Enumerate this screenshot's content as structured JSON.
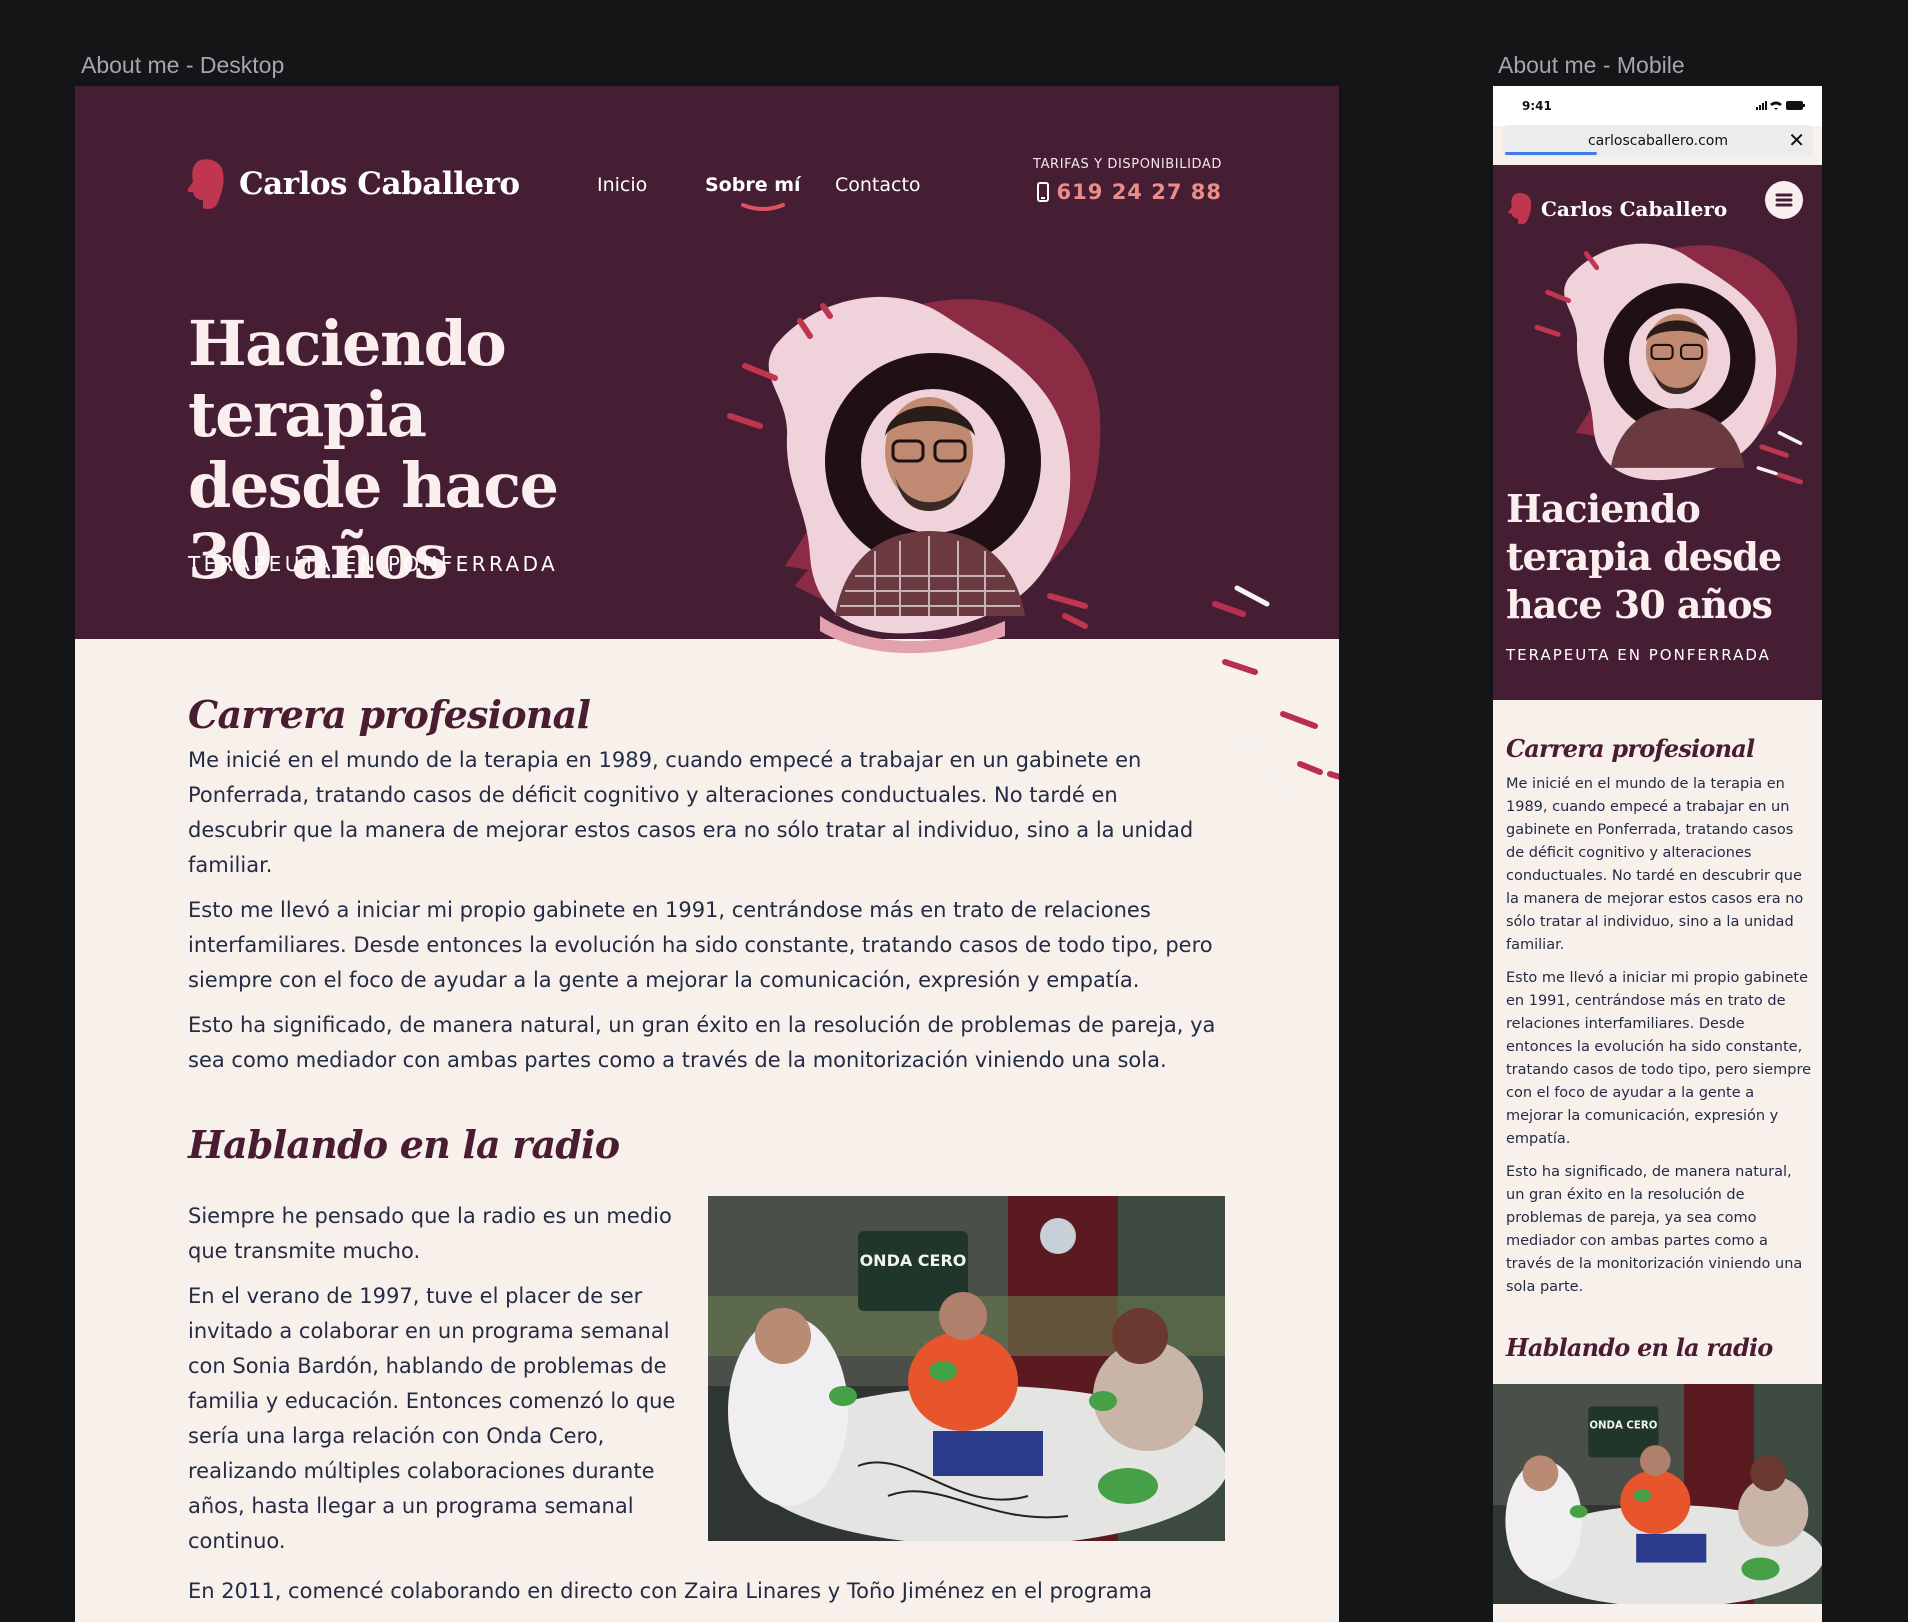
{
  "frames": {
    "desktop_label": "About me - Desktop",
    "mobile_label": "About me - Mobile"
  },
  "brand": {
    "name": "Carlos Caballero",
    "accent": "#ec8c8a",
    "hero_bg": "#461e34",
    "content_bg": "#f8f0eb"
  },
  "nav": {
    "items": [
      "Inicio",
      "Sobre mí",
      "Contacto"
    ],
    "active": "Sobre mí"
  },
  "contact": {
    "caption": "TARIFAS Y DISPONIBILIDAD",
    "phone": "619 24 27 88"
  },
  "hero": {
    "title": "Haciendo terapia desde hace 30 años",
    "subtitle": "TERAPEUTA EN PONFERRADA"
  },
  "career": {
    "heading": "Carrera profesional",
    "paragraphs": [
      "Me inicié en el mundo de la terapia en 1989, cuando empecé a trabajar en un gabinete en Ponferrada, tratando casos de déficit cognitivo y alteraciones conductuales. No tardé en descubrir que la manera de mejorar estos casos era no sólo tratar al individuo, sino a la unidad familiar.",
      "Esto me llevó a iniciar mi propio gabinete en 1991, centrándose más en trato de relaciones interfamiliares. Desde entonces la evolución ha sido constante, tratando casos de todo tipo, pero siempre con el foco de ayudar a la gente a mejorar la comunicación, expresión y empatía.",
      "Esto ha significado, de manera natural, un gran éxito en la resolución de problemas de pareja, ya sea como mediador con ambas partes como a través de la monitorización viniendo una sola."
    ],
    "mobile_last_paragraph": "Esto ha significado, de manera natural, un gran éxito en la resolución de problemas de pareja, ya sea como mediador con ambas partes como a través de la monitorización viniendo una sola parte."
  },
  "radio": {
    "heading": "Hablando en la radio",
    "paragraphs": [
      "Siempre he pensado que la radio es un medio que transmite mucho.",
      "En el verano de 1997, tuve el placer de ser invitado a colaborar en un programa semanal con Sonia Bardón, hablando de problemas de familia y educación. Entonces comenzó lo que sería una larga relación con Onda Cero, realizando múltiples colaboraciones durante años, hasta llegar a un programa semanal continuo."
    ],
    "next_paragraph": "En 2011, comencé colaborando en directo con Zaira Linares y Toño Jiménez en el programa",
    "studio_sign": "ONDA CERO"
  },
  "mobile": {
    "time": "9:41",
    "url": "carloscaballero.com"
  }
}
